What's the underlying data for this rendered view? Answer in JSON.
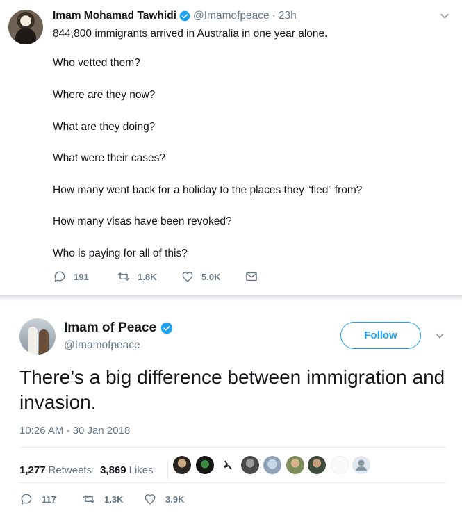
{
  "tweet1": {
    "name": "Imam Mohamad Tawhidi",
    "handle": "@Imamofpeace",
    "separator": "·",
    "time": "23h",
    "lines": [
      "844,800 immigrants arrived in Australia in one year alone.",
      "Who vetted them?",
      "Where are they now?",
      "What are they doing?",
      "What were their cases?",
      "How many went back for a holiday to the places they “fled” from?",
      "How many visas have been revoked?",
      "Who is paying for all of this?"
    ],
    "replies": "191",
    "retweets": "1.8K",
    "likes": "5.0K"
  },
  "tweet2": {
    "name": "Imam of Peace",
    "handle": "@Imamofpeace",
    "follow_label": "Follow",
    "text": "There’s a big difference between immigration and invasion.",
    "timestamp": "10:26 AM - 30 Jan 2018",
    "retweets_count": "1,277",
    "retweets_label": "Retweets",
    "likes_count": "3,869",
    "likes_label": "Likes",
    "replies": "117",
    "retweets": "1.3K",
    "likes": "3.9K"
  },
  "colors": {
    "brand_blue": "#1da1f2",
    "secondary_text": "#657786",
    "primary_text": "#14171a"
  }
}
